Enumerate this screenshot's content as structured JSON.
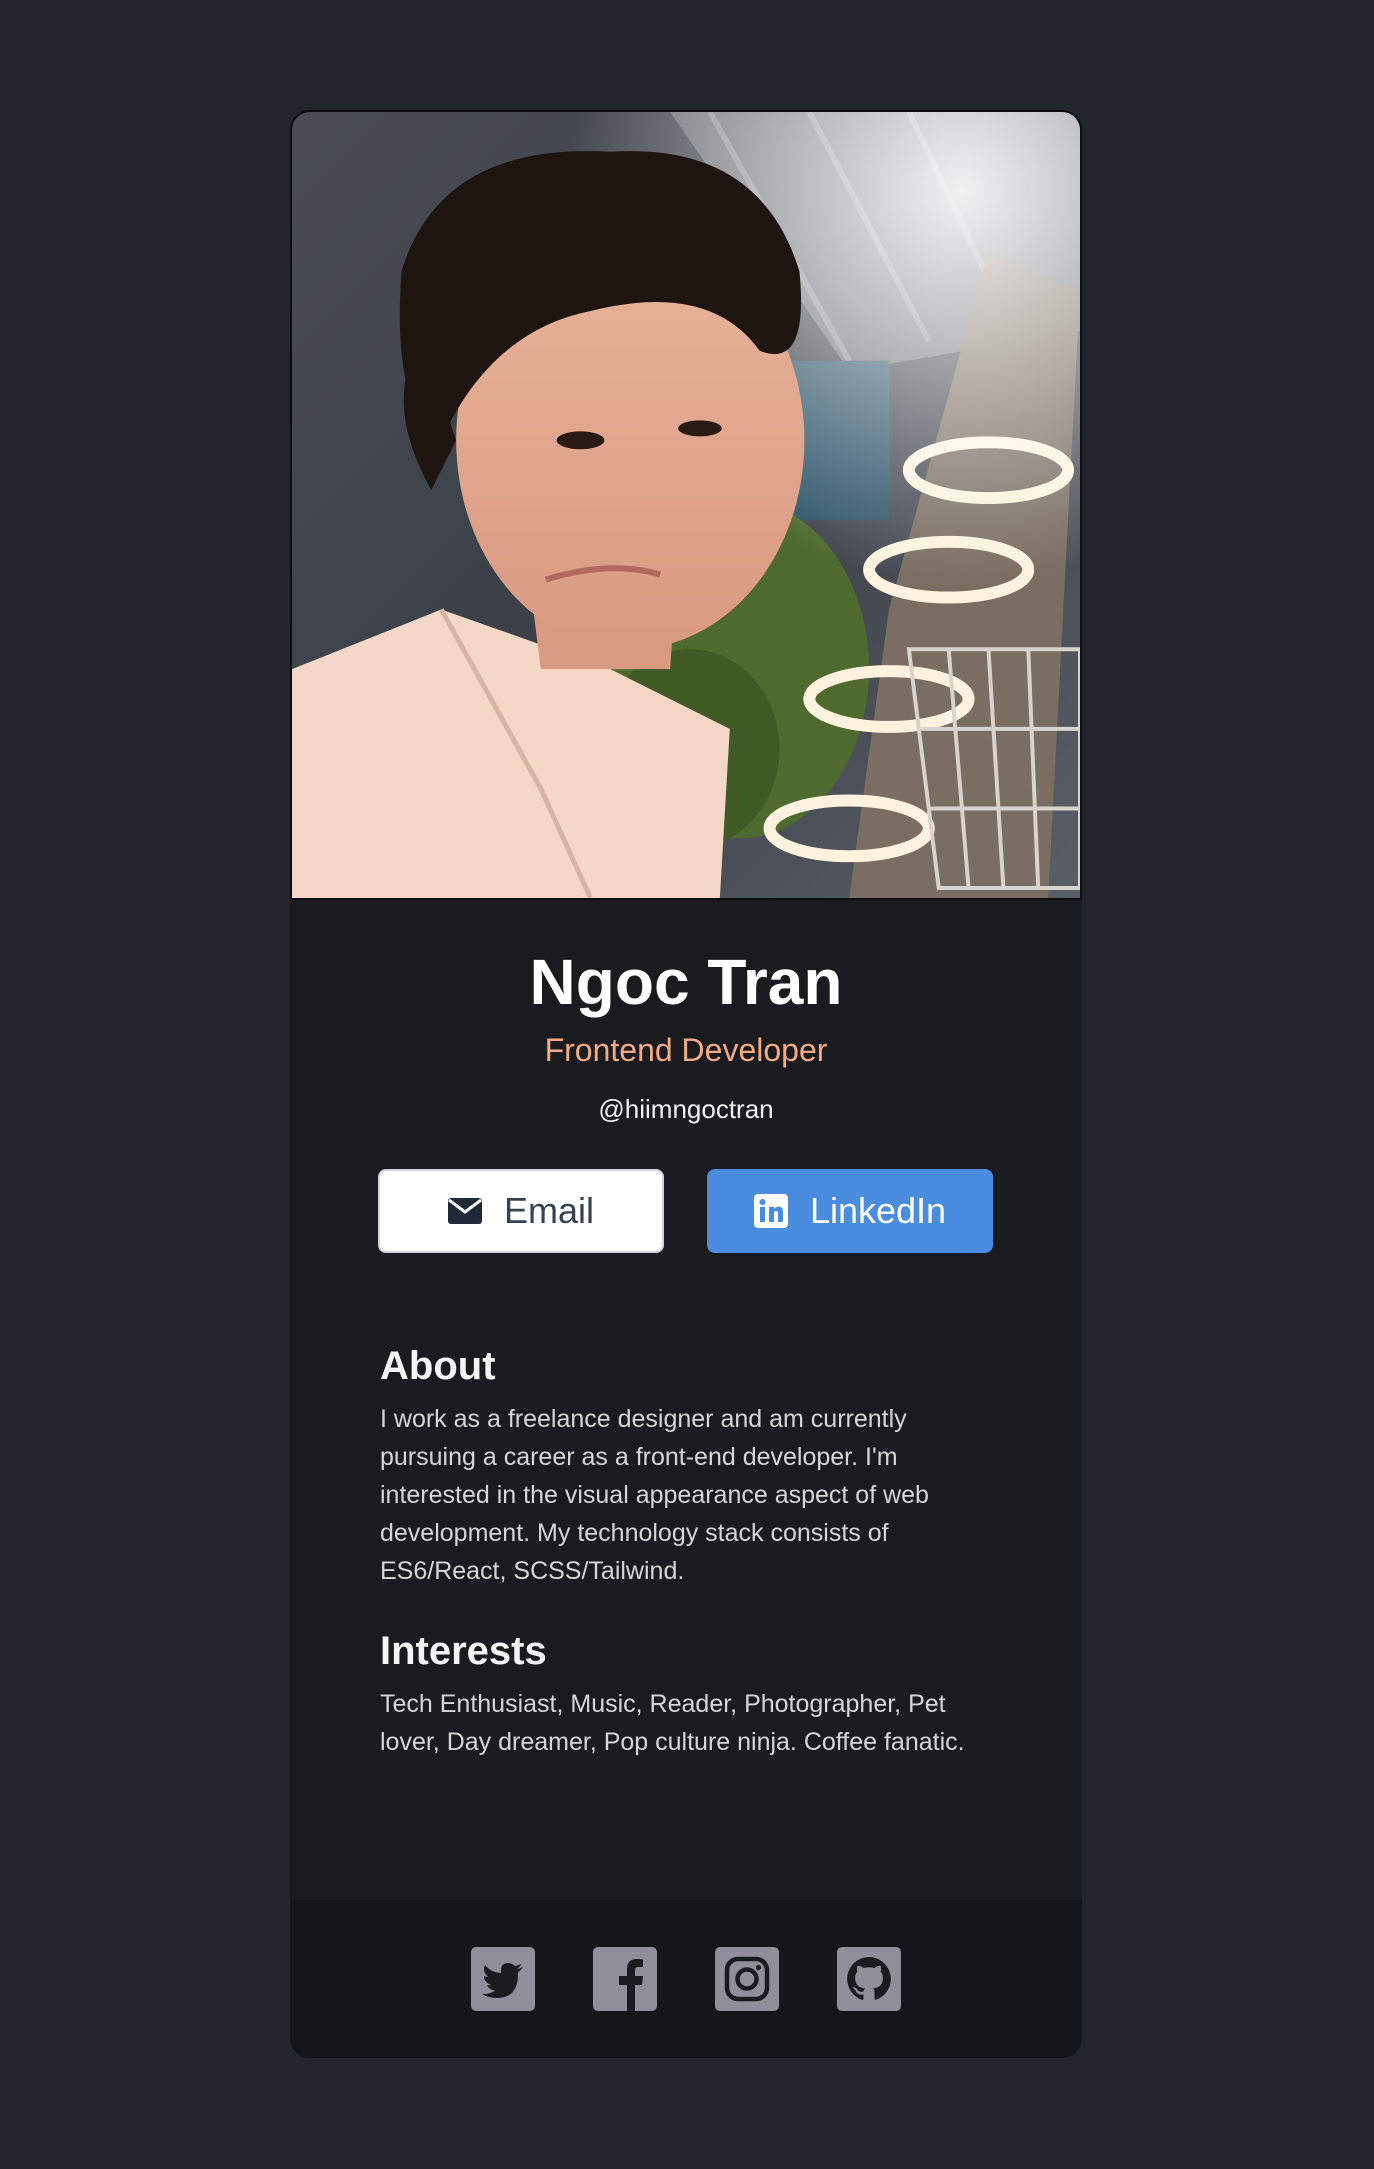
{
  "profile": {
    "name": "Ngoc Tran",
    "title": "Frontend Developer",
    "handle": "@hiimngoctran"
  },
  "buttons": {
    "email": {
      "label": "Email",
      "icon": "envelope-icon"
    },
    "linkedin": {
      "label": "LinkedIn",
      "icon": "linkedin-icon"
    }
  },
  "about": {
    "heading": "About",
    "text": "I work as a freelance designer and am currently pursuing a career as a front-end developer. I'm interested in the visual appearance aspect of web development. My technology stack consists of ES6/React, SCSS/Tailwind."
  },
  "interests": {
    "heading": "Interests",
    "text": "Tech Enthusiast, Music, Reader, Photographer, Pet lover, Day dreamer, Pop culture ninja. Coffee fanatic."
  },
  "footer": {
    "social_icons": [
      "twitter-icon",
      "facebook-icon",
      "instagram-icon",
      "github-icon"
    ]
  },
  "colors": {
    "page_background": "#23252c",
    "card_background": "#1a1b1f",
    "footer_background": "#151619",
    "title_accent": "#f2ab84",
    "linkedin_blue": "#4a8ddf",
    "social_icon": "#918e9b"
  }
}
